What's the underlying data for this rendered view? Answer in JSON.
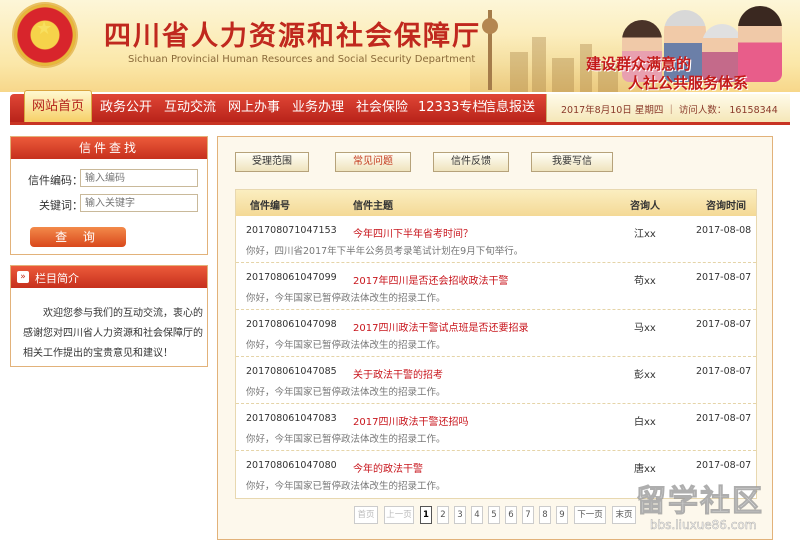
{
  "header": {
    "title": "四川省人力资源和社会保障厅",
    "subtitle": "Sichuan Provincial Human Resources and Social Security Department",
    "slogan_line1": "建设群众满意的",
    "slogan_line2": "人社公共服务体系"
  },
  "nav": {
    "items": [
      "网站首页",
      "政务公开",
      "互动交流",
      "网上办事",
      "业务办理",
      "社会保险",
      "12333专栏",
      "信息报送"
    ],
    "date_info": "2017年8月10日  星期四  ｜  访问人数：  16158344"
  },
  "search": {
    "title": "信件查找",
    "code_label": "信件编码：",
    "code_placeholder": "输入编码",
    "keyword_label": "关键词：",
    "keyword_placeholder": "输入关键字",
    "button": "查 询"
  },
  "intro": {
    "title": "栏目简介",
    "text": "欢迎您参与我们的互动交流，衷心的感谢您对四川省人力资源和社会保障厅的相关工作提出的宝贵意见和建议！"
  },
  "tabs": [
    "受理范围",
    "常见问题",
    "信件反馈",
    "我要写信"
  ],
  "list": {
    "headers": [
      "信件编号",
      "信件主题",
      "咨询人",
      "咨询时间"
    ],
    "rows": [
      {
        "id": "20170807104715​3",
        "title": "今年四川下半年省考时间？",
        "person": "江xx",
        "date": "2017-08-08",
        "reply": "你好，四川省2017年下半年公务员考录笔试计划在9月下旬举行。"
      },
      {
        "id": "201708061047099",
        "title": "2017年四川是否还会招收政法干警",
        "person": "苟xx",
        "date": "2017-08-07",
        "reply": "你好，今年国家已暂停政法体改生的招录工作。"
      },
      {
        "id": "201708061047098",
        "title": "2017四川政法干警试点班是否还要招录",
        "person": "马xx",
        "date": "2017-08-07",
        "reply": "你好，今年国家已暂停政法体改生的招录工作。"
      },
      {
        "id": "201708061047085",
        "title": "关于政法干警的招考",
        "person": "彭xx",
        "date": "2017-08-07",
        "reply": "你好，今年国家已暂停政法体改生的招录工作。"
      },
      {
        "id": "201708061047083",
        "title": "2017四川政法干警还招吗",
        "person": "白xx",
        "date": "2017-08-07",
        "reply": "你好，今年国家已暂停政法体改生的招录工作。"
      },
      {
        "id": "201708061047080",
        "title": "今年的政法干警",
        "person": "唐xx",
        "date": "2017-08-07",
        "reply": "你好，今年国家已暂停政法体改生的招录工作。"
      }
    ]
  },
  "pager": {
    "first": "首页",
    "prev": "上一页",
    "pages": [
      "1",
      "2",
      "3",
      "4",
      "5",
      "6",
      "7",
      "8",
      "9"
    ],
    "next": "下一页",
    "last": "末页"
  },
  "watermark": {
    "text": "留学社区",
    "url": "bbs.liuxue86.com"
  }
}
